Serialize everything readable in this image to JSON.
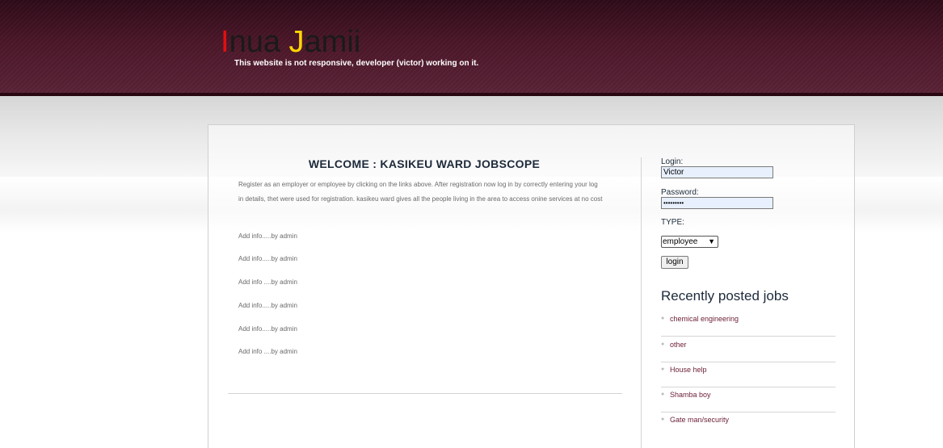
{
  "header": {
    "logo_first_letter": "I",
    "logo_part1": "nua ",
    "logo_second_letter": "J",
    "logo_part2": "amii",
    "tagline": "This website is not responsive, developer (victor) working on it."
  },
  "main": {
    "title": "WELCOME : KASIKEU WARD JOBSCOPE",
    "intro": "Register as an employer or employee by clicking on the links above. After registration now log in by correctly entering your log in details, thet were used for registration. kasikeu ward gives all the people living in the area to access onine services at no cost",
    "info_items": [
      "Add info.....by admin",
      "Add info.....by admin",
      "Add info ....by admin",
      "Add info.....by admin",
      "Add info.....by admin",
      "Add info ....by admin"
    ]
  },
  "login": {
    "login_label": "Login:",
    "login_value": "Victor",
    "password_label": "Password:",
    "password_value": "•••••••••",
    "type_label": "TYPE:",
    "type_selected": "employee",
    "button_label": "login"
  },
  "recent": {
    "title": "Recently posted jobs",
    "jobs": [
      "chemical engineering",
      "other",
      "House help",
      "Shamba boy",
      "Gate man/security"
    ]
  },
  "colors": {
    "header_bg": "#4a1628",
    "logo_accent_1": "#e01010",
    "logo_accent_2": "#ffd800",
    "link": "#6b1d33"
  }
}
